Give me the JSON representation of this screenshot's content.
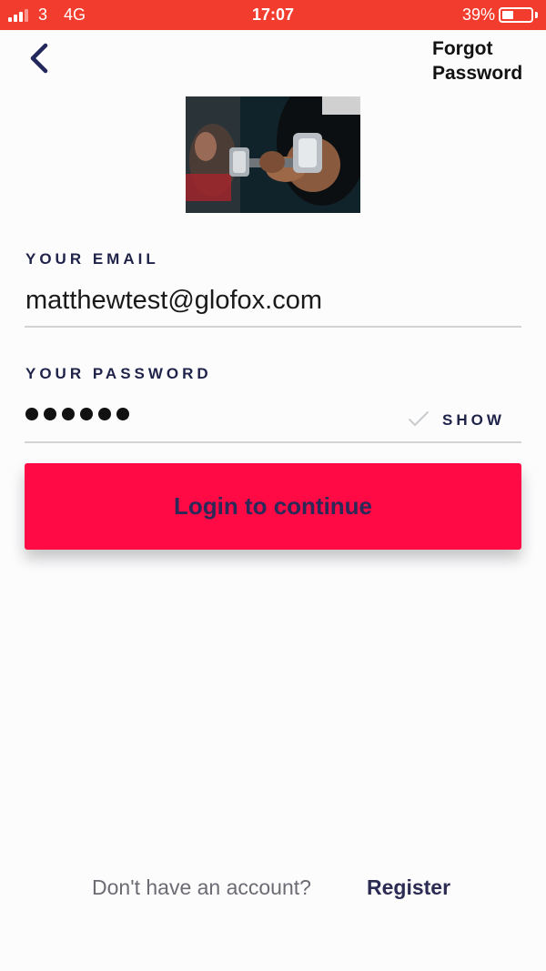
{
  "status_bar": {
    "carrier": "3",
    "network": "4G",
    "time": "17:07",
    "battery_percent": "39%",
    "battery_level": 0.39,
    "background_color": "#f23d2e"
  },
  "header": {
    "back_icon": "chevron-left-icon",
    "forgot_line1": "Forgot",
    "forgot_line2": "Password"
  },
  "hero": {
    "image": "gym-dumbbell-photo"
  },
  "form": {
    "email_label": "YOUR EMAIL",
    "email_value": "matthewtest@glofox.com",
    "password_label": "YOUR PASSWORD",
    "password_mask_length": 6,
    "show_label": "SHOW",
    "show_icon": "checkmark-icon"
  },
  "login": {
    "label": "Login to continue",
    "color": "#ff0a45"
  },
  "footer": {
    "question": "Don't have an account?",
    "register_label": "Register"
  }
}
